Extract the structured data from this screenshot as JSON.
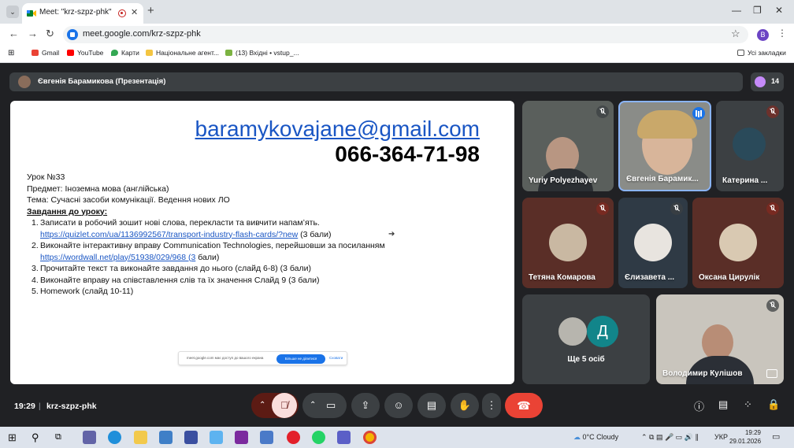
{
  "browser": {
    "tab_title": "Meet: \"krz-szpz-phk\"",
    "url": "meet.google.com/krz-szpz-phk",
    "profile_initial": "B",
    "bookmarks": [
      "Gmail",
      "YouTube",
      "Карти",
      "Національне агент...",
      "(13) Вхідні • vstup_..."
    ],
    "all_bookmarks": "Усі закладки"
  },
  "meet": {
    "presenter": "Євгенія Барамикова (Презентація)",
    "participant_count": "14",
    "time": "19:29",
    "separator": "|",
    "meeting_code": "krz-szpz-phk"
  },
  "slide": {
    "email": "baramykovajane@gmail.com",
    "phone": "066-364-71-98",
    "lines": [
      "Урок №33",
      "Предмет: Іноземна мова (англійська)",
      "Тема: Сучасні засоби комунікації. Ведення нових ЛО"
    ],
    "tasks_header": "Завдання до уроку:",
    "tasks": [
      {
        "num": "1.",
        "text": "Записати в робочий зошит нові слова, перекласти та вивчити напам’ять."
      },
      {
        "num": "",
        "link": "https://quizlet.com/ua/1136992567/transport-industry-flash-cards/?new",
        "after": " (3 бали)"
      },
      {
        "num": "2.",
        "text": "Виконайте інтерактивну вправу Communication Technologies, перейшовши за посиланням"
      },
      {
        "num": "",
        "link": "https://wordwall.net/play/51938/029/968 (3",
        "after": " бали)"
      },
      {
        "num": "3.",
        "text": "Прочитайте текст та виконайте завдання до нього (слайд 6-8) (3 бали)"
      },
      {
        "num": "4.",
        "text": "Виконайте вправу на співставлення слів та їх значення Слайд 9 (3 бали)"
      },
      {
        "num": "5.",
        "text": "Homework (слайд 10-11)"
      }
    ],
    "share_notice": "meet.google.com має доступ до вашого екрана",
    "share_stop": "Більше не ділитися",
    "share_hide": "Сховати"
  },
  "participants": [
    {
      "name": "Yuriy Polyezhayev"
    },
    {
      "name": "Євгенія Барамик..."
    },
    {
      "name": "Катерина ..."
    },
    {
      "name": "Тетяна Комарова"
    },
    {
      "name": "Єлизавета ..."
    },
    {
      "name": "Оксана Цирулік"
    },
    {
      "name": "Володимир Кулішов"
    }
  ],
  "more_people": {
    "label": "Ще 5 осіб",
    "avatar_letter": "Д"
  },
  "taskbar": {
    "weather": "0°C  Cloudy",
    "lang": "УКР",
    "time": "19:29",
    "date": "29.01.2026"
  },
  "colors": {
    "accent": "#1a73e8",
    "hangup": "#ea4335",
    "meet_bg": "#202124",
    "tile_bg": "#3c4043"
  }
}
